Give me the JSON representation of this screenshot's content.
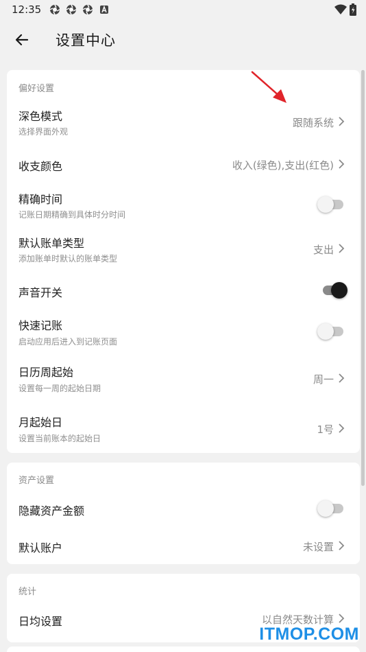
{
  "status_bar": {
    "time": "12:35"
  },
  "app_bar": {
    "title": "设置中心"
  },
  "preferences": {
    "section_title": "偏好设置",
    "dark_mode": {
      "title": "深色模式",
      "subtitle": "选择界面外观",
      "value": "跟随系统"
    },
    "income_expense_color": {
      "title": "收支颜色",
      "value": "收入(绿色),支出(红色)"
    },
    "precise_time": {
      "title": "精确时间",
      "subtitle": "记账日期精确到具体时分时间",
      "enabled": false
    },
    "default_bill_type": {
      "title": "默认账单类型",
      "subtitle": "添加账单时默认的账单类型",
      "value": "支出"
    },
    "sound": {
      "title": "声音开关",
      "enabled": true
    },
    "quick_bookkeeping": {
      "title": "快速记账",
      "subtitle": "启动应用后进入到记账页面",
      "enabled": false
    },
    "week_start": {
      "title": "日历周起始",
      "subtitle": "设置每一周的起始日期",
      "value": "周一"
    },
    "month_start": {
      "title": "月起始日",
      "subtitle": "设置当前账本的起始日",
      "value": "1号"
    }
  },
  "assets": {
    "section_title": "资产设置",
    "hide_amount": {
      "title": "隐藏资产金额",
      "enabled": false
    },
    "default_account": {
      "title": "默认账户",
      "value": "未设置"
    }
  },
  "statistics": {
    "section_title": "统计",
    "daily_average": {
      "title": "日均设置",
      "value": "以自然天数计算"
    }
  },
  "watermark": "ITMOP.COM",
  "colors": {
    "background": "#f1f1f1",
    "card": "#ffffff",
    "annotation_arrow": "#e0242a",
    "watermark": "#1e8fe6",
    "switch_on": "#1a1a1a"
  }
}
